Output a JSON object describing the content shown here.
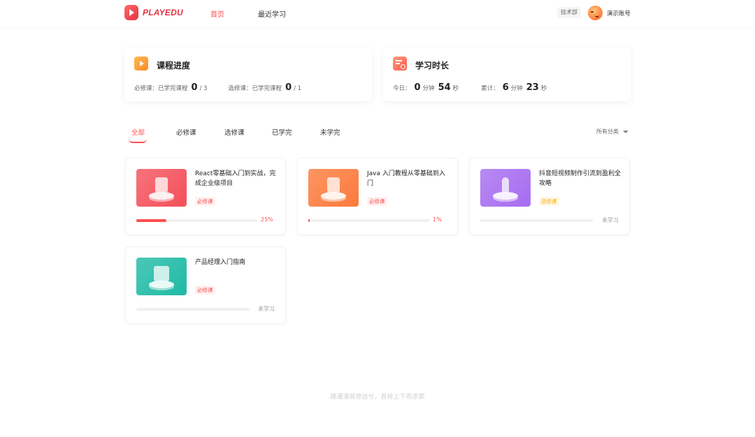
{
  "header": {
    "logo_text": "PLAYEDU",
    "nav": [
      {
        "label": "首页",
        "active": true
      },
      {
        "label": "最近学习",
        "active": false
      }
    ],
    "department": "技术部",
    "user_name": "演示账号"
  },
  "stats": {
    "progress": {
      "title": "课程进度",
      "required_label": "必修课：已学完课程",
      "required_done": "0",
      "required_total": "/ 3",
      "elective_label": "选修课：已学完课程",
      "elective_done": "0",
      "elective_total": "/ 1"
    },
    "duration": {
      "title": "学习时长",
      "today_label": "今日：",
      "today_min": "0",
      "min_unit": "分钟",
      "today_sec": "54",
      "sec_unit": "秒",
      "total_label": "累计：",
      "total_min": "6",
      "total_sec": "23"
    }
  },
  "tabs": [
    "全部",
    "必修课",
    "选修课",
    "已学完",
    "未学完"
  ],
  "active_tab": 0,
  "category_select": "所有分类",
  "courses": [
    {
      "title": "React零基础入门到实战，完成企业级项目",
      "tag": "必修课",
      "tag_type": "required",
      "progress": 0.25,
      "progress_text": "25%",
      "thumb_color": "#f4505a"
    },
    {
      "title": "Java 入门教程从零基础到入门",
      "tag": "必修课",
      "tag_type": "required",
      "progress": 0.01,
      "progress_text": "1%",
      "thumb_color": "#fb7a3c"
    },
    {
      "title": "抖音短视频制作引流到盈利全攻略",
      "tag": "选修课",
      "tag_type": "elective",
      "progress": 0,
      "progress_text": "未学习",
      "thumb_color": "#a66cf0"
    },
    {
      "title": "产品经理入门指南",
      "tag": "必修课",
      "tag_type": "required",
      "progress": 0,
      "progress_text": "未学习",
      "thumb_color": "#1fbaa6"
    }
  ],
  "footer_text": "路漫漫其修远兮，吾将上下而求索"
}
